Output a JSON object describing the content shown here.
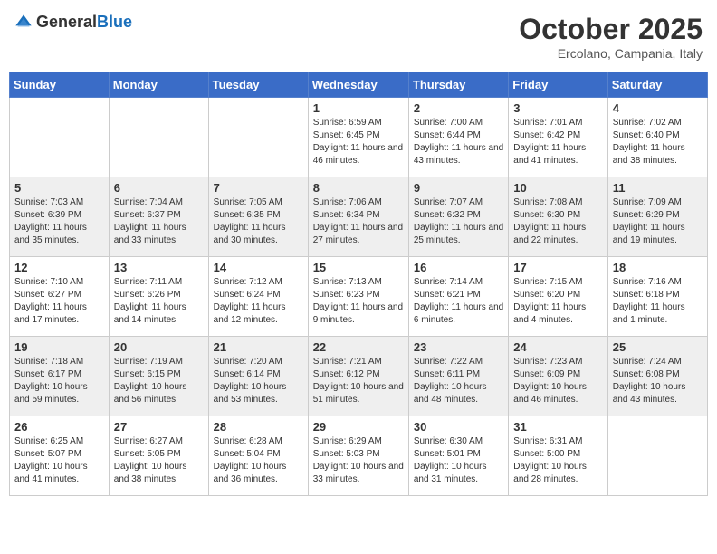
{
  "header": {
    "logo_general": "General",
    "logo_blue": "Blue",
    "month_year": "October 2025",
    "location": "Ercolano, Campania, Italy"
  },
  "days_of_week": [
    "Sunday",
    "Monday",
    "Tuesday",
    "Wednesday",
    "Thursday",
    "Friday",
    "Saturday"
  ],
  "weeks": [
    [
      {
        "day": "",
        "info": ""
      },
      {
        "day": "",
        "info": ""
      },
      {
        "day": "",
        "info": ""
      },
      {
        "day": "1",
        "info": "Sunrise: 6:59 AM\nSunset: 6:45 PM\nDaylight: 11 hours and 46 minutes."
      },
      {
        "day": "2",
        "info": "Sunrise: 7:00 AM\nSunset: 6:44 PM\nDaylight: 11 hours and 43 minutes."
      },
      {
        "day": "3",
        "info": "Sunrise: 7:01 AM\nSunset: 6:42 PM\nDaylight: 11 hours and 41 minutes."
      },
      {
        "day": "4",
        "info": "Sunrise: 7:02 AM\nSunset: 6:40 PM\nDaylight: 11 hours and 38 minutes."
      }
    ],
    [
      {
        "day": "5",
        "info": "Sunrise: 7:03 AM\nSunset: 6:39 PM\nDaylight: 11 hours and 35 minutes."
      },
      {
        "day": "6",
        "info": "Sunrise: 7:04 AM\nSunset: 6:37 PM\nDaylight: 11 hours and 33 minutes."
      },
      {
        "day": "7",
        "info": "Sunrise: 7:05 AM\nSunset: 6:35 PM\nDaylight: 11 hours and 30 minutes."
      },
      {
        "day": "8",
        "info": "Sunrise: 7:06 AM\nSunset: 6:34 PM\nDaylight: 11 hours and 27 minutes."
      },
      {
        "day": "9",
        "info": "Sunrise: 7:07 AM\nSunset: 6:32 PM\nDaylight: 11 hours and 25 minutes."
      },
      {
        "day": "10",
        "info": "Sunrise: 7:08 AM\nSunset: 6:30 PM\nDaylight: 11 hours and 22 minutes."
      },
      {
        "day": "11",
        "info": "Sunrise: 7:09 AM\nSunset: 6:29 PM\nDaylight: 11 hours and 19 minutes."
      }
    ],
    [
      {
        "day": "12",
        "info": "Sunrise: 7:10 AM\nSunset: 6:27 PM\nDaylight: 11 hours and 17 minutes."
      },
      {
        "day": "13",
        "info": "Sunrise: 7:11 AM\nSunset: 6:26 PM\nDaylight: 11 hours and 14 minutes."
      },
      {
        "day": "14",
        "info": "Sunrise: 7:12 AM\nSunset: 6:24 PM\nDaylight: 11 hours and 12 minutes."
      },
      {
        "day": "15",
        "info": "Sunrise: 7:13 AM\nSunset: 6:23 PM\nDaylight: 11 hours and 9 minutes."
      },
      {
        "day": "16",
        "info": "Sunrise: 7:14 AM\nSunset: 6:21 PM\nDaylight: 11 hours and 6 minutes."
      },
      {
        "day": "17",
        "info": "Sunrise: 7:15 AM\nSunset: 6:20 PM\nDaylight: 11 hours and 4 minutes."
      },
      {
        "day": "18",
        "info": "Sunrise: 7:16 AM\nSunset: 6:18 PM\nDaylight: 11 hours and 1 minute."
      }
    ],
    [
      {
        "day": "19",
        "info": "Sunrise: 7:18 AM\nSunset: 6:17 PM\nDaylight: 10 hours and 59 minutes."
      },
      {
        "day": "20",
        "info": "Sunrise: 7:19 AM\nSunset: 6:15 PM\nDaylight: 10 hours and 56 minutes."
      },
      {
        "day": "21",
        "info": "Sunrise: 7:20 AM\nSunset: 6:14 PM\nDaylight: 10 hours and 53 minutes."
      },
      {
        "day": "22",
        "info": "Sunrise: 7:21 AM\nSunset: 6:12 PM\nDaylight: 10 hours and 51 minutes."
      },
      {
        "day": "23",
        "info": "Sunrise: 7:22 AM\nSunset: 6:11 PM\nDaylight: 10 hours and 48 minutes."
      },
      {
        "day": "24",
        "info": "Sunrise: 7:23 AM\nSunset: 6:09 PM\nDaylight: 10 hours and 46 minutes."
      },
      {
        "day": "25",
        "info": "Sunrise: 7:24 AM\nSunset: 6:08 PM\nDaylight: 10 hours and 43 minutes."
      }
    ],
    [
      {
        "day": "26",
        "info": "Sunrise: 6:25 AM\nSunset: 5:07 PM\nDaylight: 10 hours and 41 minutes."
      },
      {
        "day": "27",
        "info": "Sunrise: 6:27 AM\nSunset: 5:05 PM\nDaylight: 10 hours and 38 minutes."
      },
      {
        "day": "28",
        "info": "Sunrise: 6:28 AM\nSunset: 5:04 PM\nDaylight: 10 hours and 36 minutes."
      },
      {
        "day": "29",
        "info": "Sunrise: 6:29 AM\nSunset: 5:03 PM\nDaylight: 10 hours and 33 minutes."
      },
      {
        "day": "30",
        "info": "Sunrise: 6:30 AM\nSunset: 5:01 PM\nDaylight: 10 hours and 31 minutes."
      },
      {
        "day": "31",
        "info": "Sunrise: 6:31 AM\nSunset: 5:00 PM\nDaylight: 10 hours and 28 minutes."
      },
      {
        "day": "",
        "info": ""
      }
    ]
  ]
}
